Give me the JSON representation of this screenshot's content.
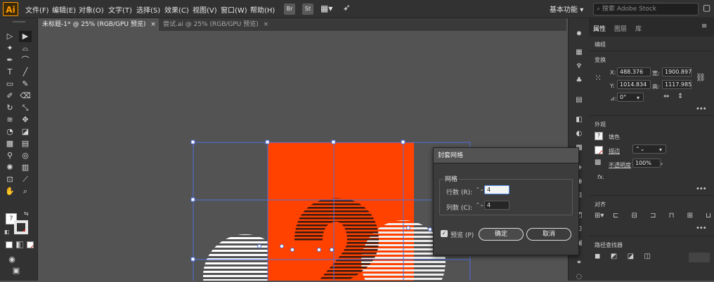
{
  "app": {
    "logo": "Ai"
  },
  "menu": [
    "文件(F)",
    "编辑(E)",
    "对象(O)",
    "文字(T)",
    "选择(S)",
    "效果(C)",
    "视图(V)",
    "窗口(W)",
    "帮助(H)"
  ],
  "appbar": {
    "bridge": "Br",
    "stock": "St",
    "workspace": "基本功能",
    "search_placeholder": "搜索 Adobe Stock"
  },
  "tabs": [
    {
      "label": "未标题-1* @ 25% (RGB/GPU 预览)",
      "close": "×"
    },
    {
      "label": "尝试.ai @ 25% (RGB/GPU 预览)",
      "close": "×"
    }
  ],
  "panel": {
    "tabs": [
      "属性",
      "图层",
      "库"
    ],
    "doc_label": "编组",
    "transform": {
      "title": "变换",
      "x_label": "X:",
      "x": "488.376",
      "y_label": "Y:",
      "y": "1014.834",
      "w_label": "宽:",
      "w": "1900.897",
      "h_label": "高:",
      "h": "1117.985",
      "angle_label": "⊿:",
      "angle": "0°"
    },
    "appearance": {
      "title": "外观",
      "fill_label": "填色",
      "stroke_label": "描边",
      "opacity_label": "不透明度",
      "opacity": "100%",
      "fx": "fx."
    },
    "align": {
      "title": "对齐"
    },
    "pathfinder": {
      "title": "路径查找器"
    }
  },
  "dialog": {
    "title": "封套网格",
    "group": "网格",
    "rows_label": "行数 (R):",
    "rows": "4",
    "cols_label": "列数 (C):",
    "cols": "4",
    "preview_label": "预览 (P)",
    "ok": "确定",
    "cancel": "取消"
  },
  "colors": {
    "accent": "#ff4200",
    "selection": "#4f6fd9",
    "chrome": "#323232"
  }
}
